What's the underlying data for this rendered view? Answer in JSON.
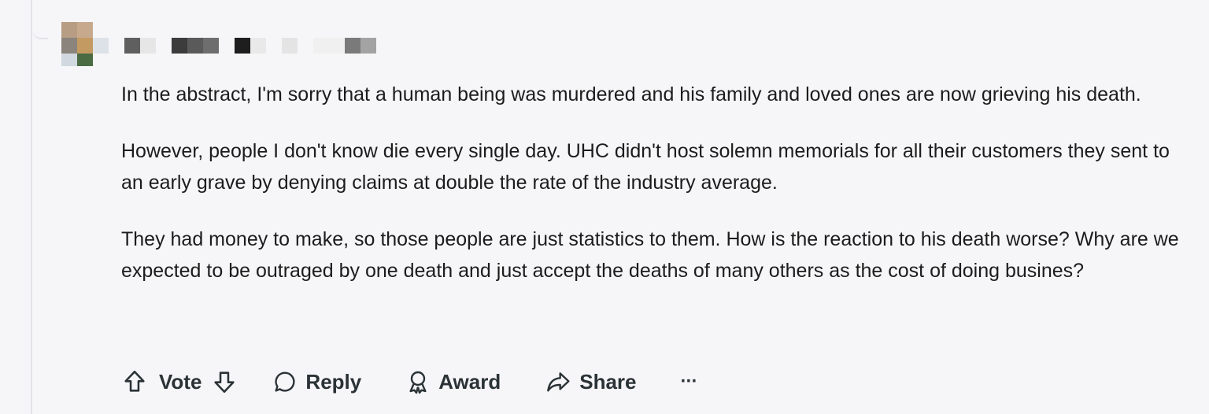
{
  "comment": {
    "paragraphs": [
      "In the abstract, I'm sorry that a human being was murdered and his family and loved ones are now grieving his death.",
      "However, people I don't know die every single day. UHC didn't host solemn memorials for all their customers they sent to an early grave by denying claims at double the rate of the industry average.",
      "They had money to make, so those people are just statistics to them. How is the reaction to his death worse? Why are we expected to be outraged by one death and just accept the deaths of many others as the cost of doing busines?"
    ]
  },
  "actions": {
    "vote_label": "Vote",
    "reply_label": "Reply",
    "award_label": "Award",
    "share_label": "Share",
    "more_label": "···"
  },
  "icons": {
    "upvote": "arrow-up-icon",
    "downvote": "arrow-down-icon",
    "reply": "speech-bubble-icon",
    "award": "award-ribbon-icon",
    "share": "share-arrow-icon",
    "more": "ellipsis-icon"
  },
  "colors": {
    "background": "#f6f6f8",
    "text": "#1c1c1c",
    "action_text": "#2a3236",
    "thread_line": "#e1e3e7"
  }
}
